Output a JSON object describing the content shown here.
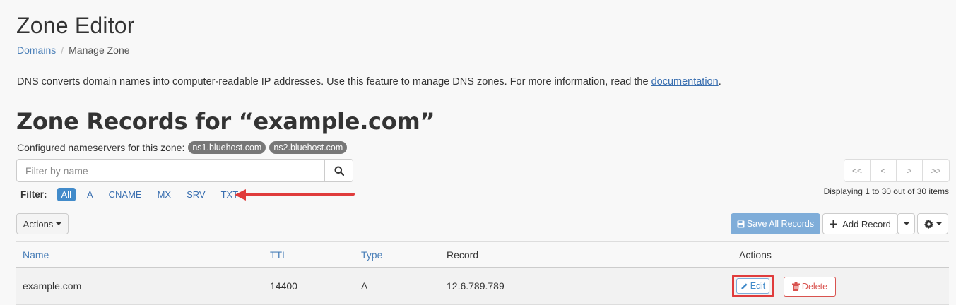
{
  "header": {
    "title": "Zone Editor",
    "breadcrumb": {
      "parent": "Domains",
      "separator": "/",
      "current": "Manage Zone"
    }
  },
  "description": {
    "text": "DNS converts domain names into computer-readable IP addresses. Use this feature to manage DNS zones. For more information, read the ",
    "link_text": "documentation",
    "suffix": "."
  },
  "zone": {
    "title": "Zone Records for “example.com”",
    "nameservers_label": "Configured nameservers for this zone:",
    "nameservers": [
      "ns1.bluehost.com",
      "ns2.bluehost.com"
    ]
  },
  "search": {
    "placeholder": "Filter by name",
    "icon": "search-icon"
  },
  "filter": {
    "label": "Filter:",
    "options": [
      "All",
      "A",
      "CNAME",
      "MX",
      "SRV",
      "TXT"
    ],
    "selected": "All"
  },
  "pagination": {
    "buttons": [
      "<<",
      "<",
      ">",
      ">>"
    ],
    "status": "Displaying 1 to 30 out of 30 items"
  },
  "toolbar": {
    "actions_label": "Actions",
    "save_all_label": "Save All Records",
    "add_record_label": "Add Record"
  },
  "table": {
    "headers": {
      "name": "Name",
      "ttl": "TTL",
      "type": "Type",
      "record": "Record",
      "actions": "Actions"
    },
    "rows": [
      {
        "name": "example.com",
        "ttl": "14400",
        "type": "A",
        "record": "12.6.789.789",
        "edit_label": "Edit",
        "delete_label": "Delete"
      }
    ]
  },
  "colors": {
    "accent": "#428bca",
    "annotation": "#e03c3c",
    "danger": "#d9534f"
  }
}
